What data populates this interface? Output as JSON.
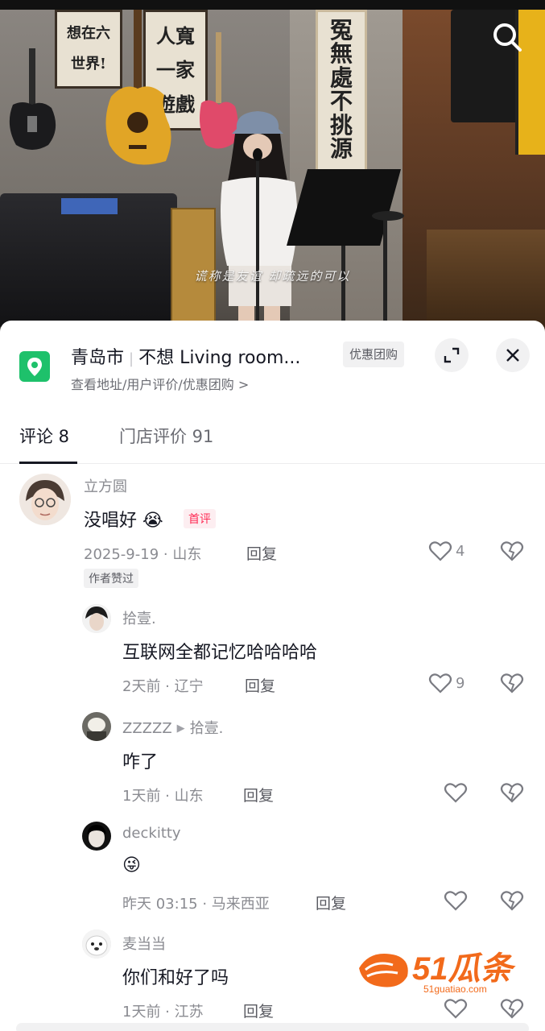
{
  "video": {
    "subtitle": "谎称是友谊 却疏远的可以",
    "search_icon": "search-icon",
    "scroll_right_text": [
      "冤",
      "無",
      "處",
      "不",
      "挑",
      "源"
    ],
    "scroll_left1_text": [
      "想",
      "在",
      "六",
      "世",
      "界",
      "!"
    ],
    "scroll_left2_text": [
      "人",
      "寬",
      "一",
      "家",
      "遊",
      "戲"
    ]
  },
  "poi": {
    "city": "青岛市",
    "name": "不想 Living room...",
    "subtitle": "查看地址/用户评价/优惠团购 >",
    "tag": "优惠团购",
    "icon": "location-pin-icon",
    "accent": "#1ec16b"
  },
  "tabs": [
    {
      "label": "评论 8"
    },
    {
      "label": "门店评价 91"
    }
  ],
  "comments": [
    {
      "user": "立方圆",
      "text": "没唱好",
      "emoji": "😭",
      "badge": "首评",
      "meta": "2025-9-19 · 山东",
      "reply": "回复",
      "likes": "4",
      "author_badge": "作者赞过"
    },
    {
      "user": "拾壹.",
      "text": "互联网全都记忆哈哈哈哈",
      "meta": "2天前 · 辽宁",
      "reply": "回复",
      "likes": "9"
    },
    {
      "user": "ZZZZZ",
      "reply_to": "拾壹.",
      "text": "咋了",
      "meta": "1天前 · 山东",
      "reply": "回复"
    },
    {
      "user": "deckitty",
      "text": "😜",
      "meta": "昨天 03:15 · 马来西亚",
      "reply": "回复"
    },
    {
      "user": "麦当当",
      "text": "你们和好了吗",
      "meta": "1天前 · 江苏",
      "reply": "回复"
    }
  ],
  "watermark": {
    "logo": "51瓜条",
    "url": "51guatiao.com",
    "color": "#f26a1b"
  }
}
